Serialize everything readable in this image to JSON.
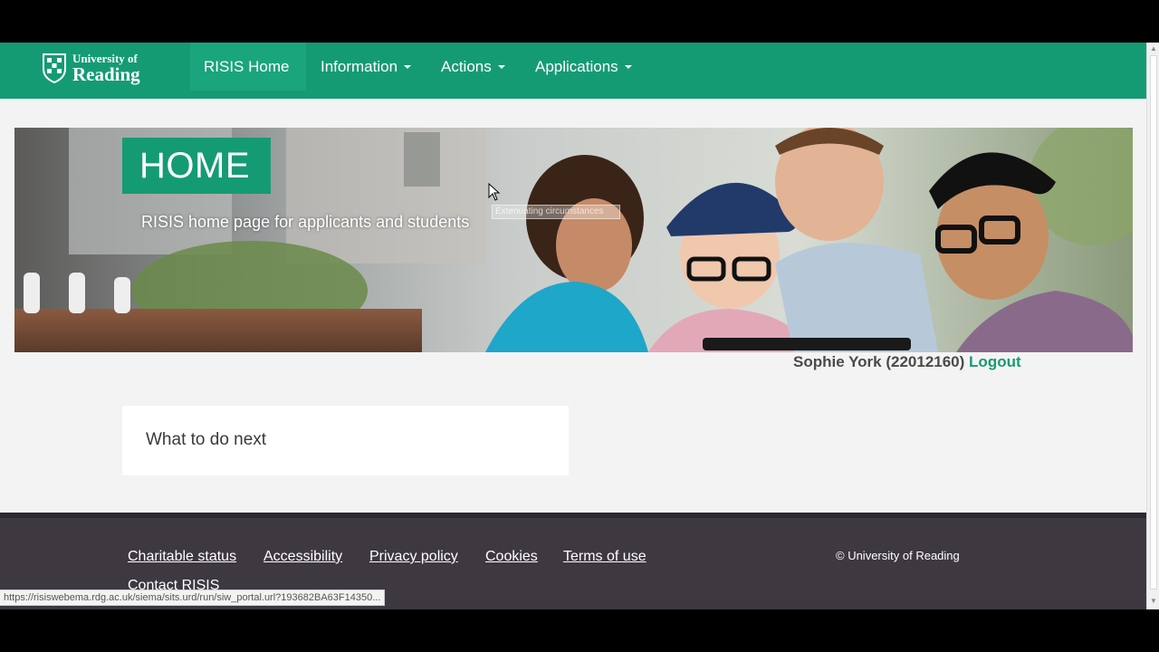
{
  "navbar": {
    "logo_line1": "University of",
    "logo_line2": "Reading",
    "items": [
      {
        "label": "RISIS Home",
        "active": true
      },
      {
        "label": "Information",
        "dropdown": true
      },
      {
        "label": "Actions",
        "dropdown": true
      },
      {
        "label": "Applications",
        "dropdown": true
      }
    ]
  },
  "hero": {
    "title": "HOME",
    "subtitle": "RISIS home page for applicants and students",
    "tooltip": "Extenuating circumstances"
  },
  "user": {
    "name": "Sophie York (22012160)",
    "logout_label": "Logout"
  },
  "card": {
    "title": "What to do next"
  },
  "footer": {
    "links": [
      {
        "label": "Charitable status"
      },
      {
        "label": "Accessibility"
      },
      {
        "label": "Privacy policy"
      },
      {
        "label": "Cookies"
      },
      {
        "label": "Terms of use"
      },
      {
        "label": "Contact RISIS"
      }
    ],
    "copyright": "© University of Reading"
  },
  "status_bar": {
    "url": "https://risiswebema.rdg.ac.uk/siema/sits.urd/run/siw_portal.url?193682BA63F14350..."
  },
  "colors": {
    "brand_green": "#159b74",
    "footer_bg": "#3e3841",
    "page_bg": "#f4f3f3"
  }
}
